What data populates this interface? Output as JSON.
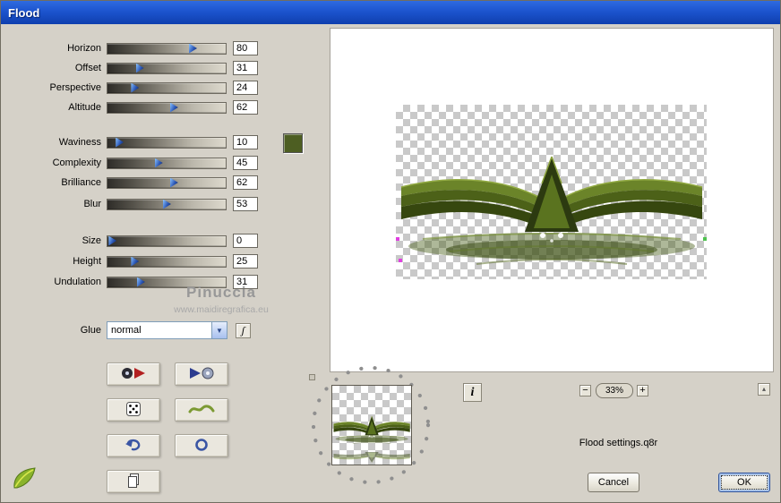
{
  "window": {
    "title": "Flood"
  },
  "sliders": [
    {
      "label": "Horizon",
      "value": "80",
      "pos": 72
    },
    {
      "label": "Offset",
      "value": "31",
      "pos": 27
    },
    {
      "label": "Perspective",
      "value": "24",
      "pos": 23
    },
    {
      "label": "Altitude",
      "value": "62",
      "pos": 56
    },
    {
      "label": "Waviness",
      "value": "10",
      "pos": 10
    },
    {
      "label": "Complexity",
      "value": "45",
      "pos": 43
    },
    {
      "label": "Brilliance",
      "value": "62",
      "pos": 56
    },
    {
      "label": "Blur",
      "value": "53",
      "pos": 50
    },
    {
      "label": "Size",
      "value": "0",
      "pos": 4
    },
    {
      "label": "Height",
      "value": "25",
      "pos": 23
    },
    {
      "label": "Undulation",
      "value": "31",
      "pos": 28
    }
  ],
  "color_swatch": {
    "color": "#4d5e22"
  },
  "watermark": {
    "name": "Pinuccia",
    "url": "www.maidiregrafica.eu"
  },
  "glue": {
    "label": "Glue",
    "value": "normal",
    "memory_glyph": "ʃ"
  },
  "buttons": {
    "icons": [
      "cd-red-arrow",
      "blue-arrow-cd",
      "dice-random",
      "wave",
      "undo",
      "ring",
      "copy-page"
    ]
  },
  "preview": {
    "info_glyph": "i",
    "dropdown_glyph": "▼",
    "scroll_glyph": "▴"
  },
  "zoom": {
    "minus": "−",
    "value": "33%",
    "plus": "+"
  },
  "footer": {
    "settings_file": "Flood settings.q8r",
    "cancel_label": "Cancel",
    "ok_label": "OK"
  }
}
